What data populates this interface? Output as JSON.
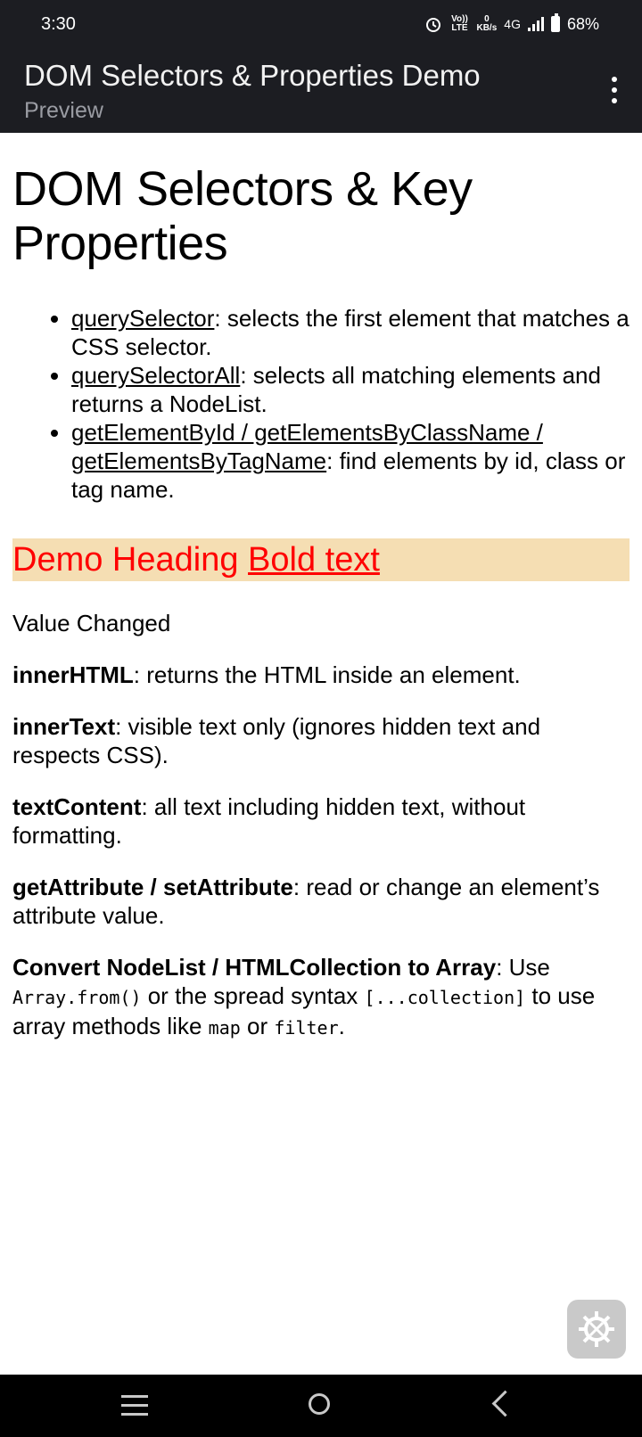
{
  "status": {
    "time": "3:30",
    "volte": "Vo)) LTE",
    "speed_value": "0",
    "speed_unit": "KB/s",
    "network": "4G",
    "battery": "68%"
  },
  "appbar": {
    "title": "DOM Selectors & Properties Demo",
    "subtitle": "Preview"
  },
  "content": {
    "heading": "DOM Selectors & Key Properties",
    "list": [
      {
        "term": "querySelector",
        "desc": ": selects the first element that matches a CSS selector."
      },
      {
        "term": "querySelectorAll",
        "desc": ": selects all matching elements and returns a NodeList."
      },
      {
        "term": "getElementById / getElementsByClassName / getElementsByTagName",
        "desc": ": find elements by id, class or tag name."
      }
    ],
    "demo_heading": "Demo Heading",
    "demo_bold": "Bold text",
    "value_text": "Value Changed",
    "props": [
      {
        "term": "innerHTML",
        "desc": ": returns the HTML inside an element."
      },
      {
        "term": "innerText",
        "desc": ": visible text only (ignores hidden text and respects CSS)."
      },
      {
        "term": "textContent",
        "desc": ": all text including hidden text, without formatting."
      },
      {
        "term": "getAttribute / setAttribute",
        "desc": ": read or change an element’s attribute value."
      }
    ],
    "convert": {
      "term": "Convert NodeList / HTMLCollection to Array",
      "t1": ": Use ",
      "c1": "Array.from()",
      "t2": " or the spread syntax ",
      "c2": "[...collection]",
      "t3": " to use array methods like ",
      "c3": "map",
      "t4": " or ",
      "c4": "filter",
      "t5": "."
    }
  },
  "icons": {
    "fab": "settings-gear-icon",
    "nav": [
      "recents-icon",
      "home-icon",
      "back-icon"
    ]
  },
  "colors": {
    "bar": "#1c1d22",
    "demo_bg": "#f5deb3",
    "demo_text": "#ff0000"
  }
}
